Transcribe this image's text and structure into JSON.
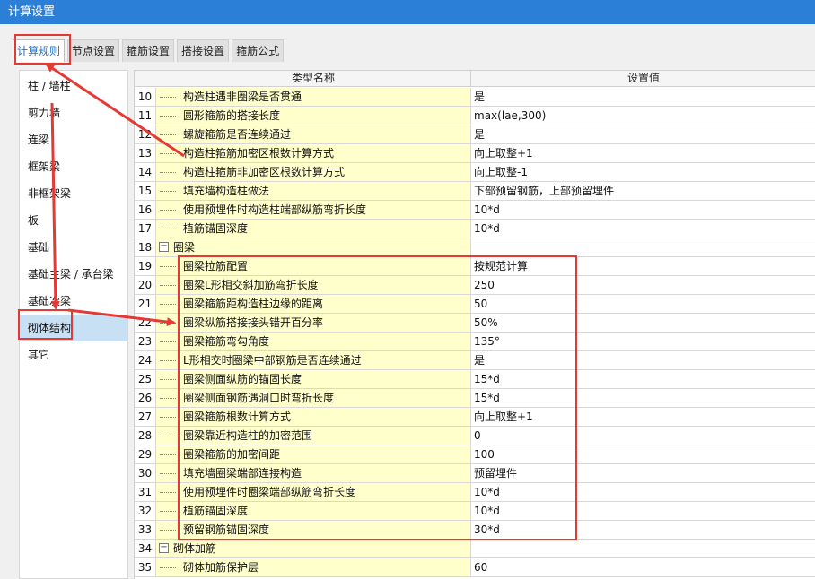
{
  "window": {
    "title": "计算设置"
  },
  "tabs": [
    {
      "label": "计算规则"
    },
    {
      "label": "节点设置"
    },
    {
      "label": "箍筋设置"
    },
    {
      "label": "搭接设置"
    },
    {
      "label": "箍筋公式"
    }
  ],
  "sidebar": {
    "items": [
      {
        "label": "柱 / 墙柱"
      },
      {
        "label": "剪力墙"
      },
      {
        "label": "连梁"
      },
      {
        "label": "框架梁"
      },
      {
        "label": "非框架梁"
      },
      {
        "label": "板"
      },
      {
        "label": "基础"
      },
      {
        "label": "基础主梁 / 承台梁"
      },
      {
        "label": "基础次梁"
      },
      {
        "label": "砌体结构"
      },
      {
        "label": "其它"
      }
    ]
  },
  "grid": {
    "headers": {
      "name": "类型名称",
      "value": "设置值"
    },
    "rows": [
      {
        "num": "10",
        "name": "构造柱遇非圈梁是否贯通",
        "value": "是"
      },
      {
        "num": "11",
        "name": "圆形箍筋的搭接长度",
        "value": "max(lae,300)"
      },
      {
        "num": "12",
        "name": "螺旋箍筋是否连续通过",
        "value": "是"
      },
      {
        "num": "13",
        "name": "构造柱箍筋加密区根数计算方式",
        "value": "向上取整+1"
      },
      {
        "num": "14",
        "name": "构造柱箍筋非加密区根数计算方式",
        "value": "向上取整-1"
      },
      {
        "num": "15",
        "name": "填充墙构造柱做法",
        "value": "下部预留钢筋，上部预留埋件"
      },
      {
        "num": "16",
        "name": "使用预埋件时构造柱端部纵筋弯折长度",
        "value": "10*d"
      },
      {
        "num": "17",
        "name": "植筋锚固深度",
        "value": "10*d"
      },
      {
        "num": "18",
        "name": "圈梁",
        "value": "",
        "group": true,
        "toggle": "−"
      },
      {
        "num": "19",
        "name": "圈梁拉筋配置",
        "value": "按规范计算"
      },
      {
        "num": "20",
        "name": "圈梁L形相交斜加筋弯折长度",
        "value": "250"
      },
      {
        "num": "21",
        "name": "圈梁箍筋距构造柱边缘的距离",
        "value": "50"
      },
      {
        "num": "22",
        "name": "圈梁纵筋搭接接头错开百分率",
        "value": "50%"
      },
      {
        "num": "23",
        "name": "圈梁箍筋弯勾角度",
        "value": "135°"
      },
      {
        "num": "24",
        "name": "L形相交时圈梁中部钢筋是否连续通过",
        "value": "是"
      },
      {
        "num": "25",
        "name": "圈梁侧面纵筋的锚固长度",
        "value": "15*d"
      },
      {
        "num": "26",
        "name": "圈梁侧面钢筋遇洞口时弯折长度",
        "value": "15*d"
      },
      {
        "num": "27",
        "name": "圈梁箍筋根数计算方式",
        "value": "向上取整+1"
      },
      {
        "num": "28",
        "name": "圈梁靠近构造柱的加密范围",
        "value": "0"
      },
      {
        "num": "29",
        "name": "圈梁箍筋的加密间距",
        "value": "100"
      },
      {
        "num": "30",
        "name": "填充墙圈梁端部连接构造",
        "value": "预留埋件"
      },
      {
        "num": "31",
        "name": "使用预埋件时圈梁端部纵筋弯折长度",
        "value": "10*d"
      },
      {
        "num": "32",
        "name": "植筋锚固深度",
        "value": "10*d"
      },
      {
        "num": "33",
        "name": "预留钢筋锚固深度",
        "value": "30*d"
      },
      {
        "num": "34",
        "name": "砌体加筋",
        "value": "",
        "group": true,
        "toggle": "−"
      },
      {
        "num": "35",
        "name": "砌体加筋保护层",
        "value": "60"
      }
    ]
  },
  "colors": {
    "annotation": "#e53935",
    "titlebar": "#2b7fd6",
    "name_cell": "#ffffcc",
    "selected": "#c7e0f4"
  }
}
